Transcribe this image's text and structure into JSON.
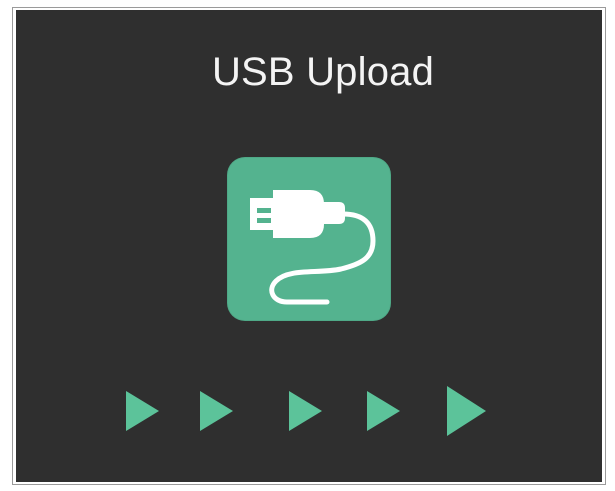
{
  "screen": {
    "title": "USB Upload",
    "background_color": "#2f2f2f",
    "accent_color": "#5cc39a",
    "tile_color": "#54b38f",
    "icon": "usb-cable-icon",
    "progress_arrows": [
      {
        "name": "progress-arrow-1",
        "icon": "play-arrow-icon"
      },
      {
        "name": "progress-arrow-2",
        "icon": "play-arrow-icon"
      },
      {
        "name": "progress-arrow-3",
        "icon": "play-arrow-icon"
      },
      {
        "name": "progress-arrow-4",
        "icon": "play-arrow-icon"
      },
      {
        "name": "progress-arrow-5",
        "icon": "play-arrow-icon"
      }
    ]
  }
}
